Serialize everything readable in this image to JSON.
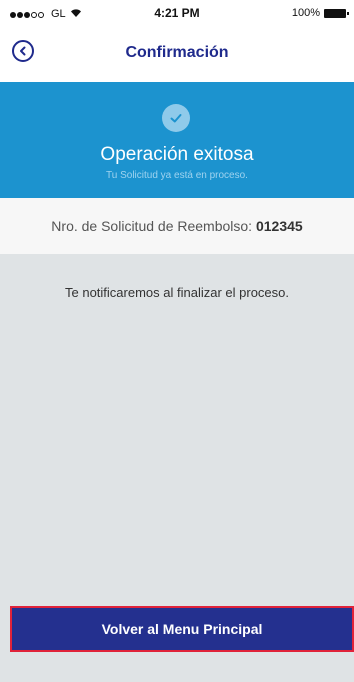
{
  "status_bar": {
    "carrier": "GL",
    "time": "4:21 PM",
    "battery": "100%"
  },
  "nav": {
    "back_icon": "chevron-left-circle-icon",
    "title": "Confirmación"
  },
  "hero": {
    "icon": "check-circle-icon",
    "title": "Operación exitosa",
    "subtitle": "Tu Solicitud ya está en proceso."
  },
  "request": {
    "label": "Nro. de Solicitud de Reembolso:",
    "number": "012345"
  },
  "notice": "Te notificaremos al finalizar el proceso.",
  "main_button": "Volver al Menu Principal",
  "colors": {
    "primary": "#1f2a8c",
    "hero_bg": "#1c93cf",
    "content_bg": "#dfe3e5",
    "button_border": "#e0233a"
  }
}
